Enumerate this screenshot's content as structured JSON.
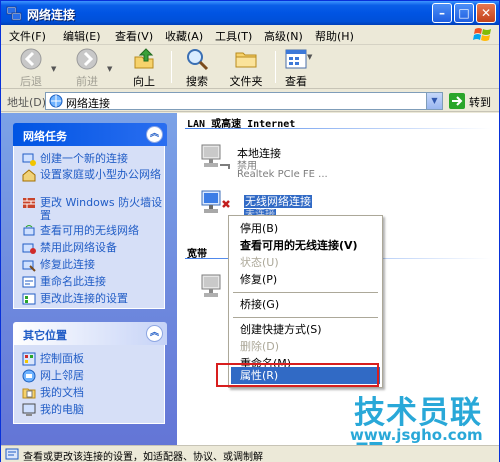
{
  "window": {
    "title": "网络连接",
    "minimize": "–",
    "maximize": "□",
    "close": "✕"
  },
  "menu": [
    {
      "label": "文件(F)"
    },
    {
      "label": "编辑(E)"
    },
    {
      "label": "查看(V)"
    },
    {
      "label": "收藏(A)"
    },
    {
      "label": "工具(T)"
    },
    {
      "label": "高级(N)"
    },
    {
      "label": "帮助(H)"
    }
  ],
  "toolbar": {
    "back": "后退",
    "forward": "前进",
    "up": "向上",
    "search": "搜索",
    "folders": "文件夹",
    "views": "查看"
  },
  "address": {
    "label": "地址(D)",
    "value": "网络连接",
    "go": "转到"
  },
  "tasks_panel": {
    "title": "网络任务",
    "items": [
      {
        "label": "创建一个新的连接"
      },
      {
        "label": "设置家庭或小型办公网络"
      },
      {
        "label": "更改 Windows 防火墙设置"
      },
      {
        "label": "查看可用的无线网络"
      },
      {
        "label": "禁用此网络设备"
      },
      {
        "label": "修复此连接"
      },
      {
        "label": "重命名此连接"
      },
      {
        "label": "更改此连接的设置"
      }
    ]
  },
  "places_panel": {
    "title": "其它位置",
    "items": [
      {
        "label": "控制面板"
      },
      {
        "label": "网上邻居"
      },
      {
        "label": "我的文档"
      },
      {
        "label": "我的电脑"
      }
    ]
  },
  "content": {
    "group_lan": "LAN 或高速 Internet",
    "group_broadband": "宽带",
    "local": {
      "name": "本地连接",
      "status": "禁用",
      "device": "Realtek PCIe FE ..."
    },
    "wireless": {
      "name": "无线网络连接",
      "status": "未连接"
    }
  },
  "context_menu": [
    {
      "label": "停用(B)"
    },
    {
      "label": "查看可用的无线连接(V)"
    },
    {
      "label": "状态(U)"
    },
    {
      "label": "修复(P)"
    },
    {
      "label": "桥接(G)"
    },
    {
      "label": "创建快捷方式(S)"
    },
    {
      "label": "删除(D)"
    },
    {
      "label": "重命名(M)"
    },
    {
      "label": "属性(R)"
    }
  ],
  "status": {
    "text": "查看或更改该连接的设置，如适配器、协议、或调制解"
  },
  "watermark": {
    "brand": "技术员联盟",
    "url": "www.jsgho.com"
  },
  "colors": {
    "title_bar": "#0054e3",
    "task_pane": "#6375d6",
    "link": "#215dc6",
    "selection": "#316ac5",
    "highlight_box": "#d81e1e",
    "watermark": "#29a8d8"
  }
}
